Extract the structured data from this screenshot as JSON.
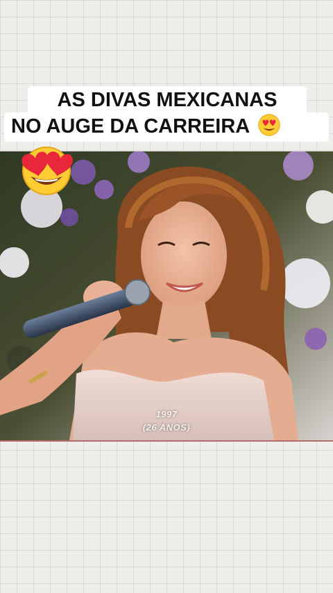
{
  "caption": {
    "line1": "AS DIVAS MEXICANAS",
    "line2": "NO AUGE DA CARREIRA",
    "emoji_name": "heart-eyes-emoji"
  },
  "video": {
    "year": "1997",
    "age": "(26 ANOS)"
  },
  "sticker": {
    "emoji_name": "heart-eyes-emoji"
  },
  "colors": {
    "background": "#efeeeb",
    "caption_bg": "#ffffff",
    "caption_text": "#111111"
  }
}
